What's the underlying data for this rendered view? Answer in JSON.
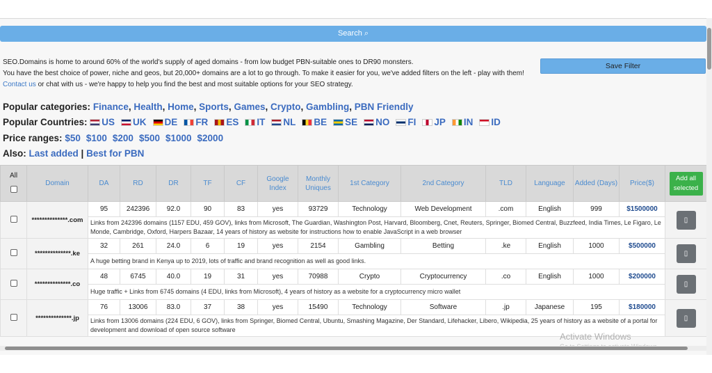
{
  "search_label": "Search ⌕",
  "save_filter": "Save Filter",
  "intro": {
    "line1": "SEO.Domains is home to around 60% of the world's supply of aged domains - from low budget PBN-suitable ones to DR90 monsters.",
    "line2": "You have the best choice of power, niche and geos, but 20,000+ domains are a lot to go through. To make it easier for you, we've added filters on the left - play with them!",
    "contact_link": "Contact us",
    "line3_rest": " or chat with us - we're happy to help you find the best and most suitable options for your SEO strategy."
  },
  "categories": {
    "label": "Popular categories:",
    "items": [
      "Finance",
      "Health",
      "Home",
      "Sports",
      "Games",
      "Crypto",
      "Gambling",
      "PBN Friendly"
    ]
  },
  "countries": {
    "label": "Popular Countries:",
    "items": [
      {
        "code": "US",
        "colors": [
          "#b22234",
          "#fff",
          "#3c3b6e"
        ]
      },
      {
        "code": "UK",
        "colors": [
          "#012169",
          "#fff",
          "#c8102e"
        ]
      },
      {
        "code": "DE",
        "colors": [
          "#000",
          "#dd0000",
          "#ffce00"
        ]
      },
      {
        "code": "FR",
        "colors": [
          "#0055a4",
          "#fff",
          "#ef4135"
        ]
      },
      {
        "code": "ES",
        "colors": [
          "#aa151b",
          "#f1bf00",
          "#aa151b"
        ]
      },
      {
        "code": "IT",
        "colors": [
          "#009246",
          "#fff",
          "#ce2b37"
        ]
      },
      {
        "code": "NL",
        "colors": [
          "#ae1c28",
          "#fff",
          "#21468b"
        ]
      },
      {
        "code": "BE",
        "colors": [
          "#000",
          "#fdda24",
          "#ef3340"
        ]
      },
      {
        "code": "SE",
        "colors": [
          "#006aa7",
          "#fecc00",
          "#006aa7"
        ]
      },
      {
        "code": "NO",
        "colors": [
          "#ba0c2f",
          "#fff",
          "#00205b"
        ]
      },
      {
        "code": "FI",
        "colors": [
          "#fff",
          "#002f6c",
          "#fff"
        ]
      },
      {
        "code": "JP",
        "colors": [
          "#fff",
          "#bc002d",
          "#fff"
        ]
      },
      {
        "code": "IN",
        "colors": [
          "#ff9933",
          "#fff",
          "#138808"
        ]
      },
      {
        "code": "ID",
        "colors": [
          "#ce1126",
          "#fff",
          "#fff"
        ]
      }
    ]
  },
  "prices": {
    "label": "Price ranges:",
    "items": [
      "$50",
      "$100",
      "$200",
      "$500",
      "$1000",
      "$2000"
    ]
  },
  "also": {
    "label": "Also:",
    "items": [
      "Last added",
      "Best for PBN"
    ],
    "separator": "|"
  },
  "table": {
    "all_label": "All",
    "headers": [
      "Domain",
      "DA",
      "RD",
      "DR",
      "TF",
      "CF",
      "Google Index",
      "Monthly Uniques",
      "1st Category",
      "2nd Category",
      "TLD",
      "Language",
      "Added (Days)",
      "Price($)"
    ],
    "add_all": "Add all selected",
    "action_icon": "cart-icon",
    "action_glyph": "▯",
    "rows": [
      {
        "domain": "**************.com",
        "da": "95",
        "rd": "242396",
        "dr": "92.0",
        "tf": "90",
        "cf": "83",
        "index": "yes",
        "uniques": "93729",
        "cat1": "Technology",
        "cat2": "Web Development",
        "tld": ".com",
        "lang": "English",
        "added": "999",
        "price": "$1500000",
        "desc": "Links from 242396 domains (1157 EDU, 459 GOV), links from Microsoft, The Guardian, Washington Post, Harvard, Bloomberg, Cnet, Reuters, Springer, Biomed Central, Buzzfeed, India Times, Le Figaro, Le Monde, Cambridge, Oxford, Harpers Bazaar, 14 years of history as website for instructions how to enable JavaScript in a web browser"
      },
      {
        "domain": "**************.ke",
        "da": "32",
        "rd": "261",
        "dr": "24.0",
        "tf": "6",
        "cf": "19",
        "index": "yes",
        "uniques": "2154",
        "cat1": "Gambling",
        "cat2": "Betting",
        "tld": ".ke",
        "lang": "English",
        "added": "1000",
        "price": "$500000",
        "desc": "A huge betting brand in Kenya up to 2019, lots of traffic and brand recognition as well as good links."
      },
      {
        "domain": "**************.co",
        "da": "48",
        "rd": "6745",
        "dr": "40.0",
        "tf": "19",
        "cf": "31",
        "index": "yes",
        "uniques": "70988",
        "cat1": "Crypto",
        "cat2": "Cryptocurrency",
        "tld": ".co",
        "lang": "English",
        "added": "1000",
        "price": "$200000",
        "desc": "Huge traffic + Links from 6745 domains (4 EDU, links from Microsoft), 4 years of history as a website for a cryptocurrency micro wallet"
      },
      {
        "domain": "**************.jp",
        "da": "76",
        "rd": "13006",
        "dr": "83.0",
        "tf": "37",
        "cf": "38",
        "index": "yes",
        "uniques": "15490",
        "cat1": "Technology",
        "cat2": "Software",
        "tld": ".jp",
        "lang": "Japanese",
        "added": "195",
        "price": "$180000",
        "desc": "Links from 13006 domains (224 EDU, 6 GOV), links from Springer, Biomed Central, Ubuntu, Smashing Magazine, Der Standard, Lifehacker, Libero, Wikipedia, 25 years of history as a website of a portal for development and download of open source software"
      }
    ]
  },
  "watermark": {
    "title": "Activate Windows",
    "sub": "Go to Settings to activate Windows."
  }
}
